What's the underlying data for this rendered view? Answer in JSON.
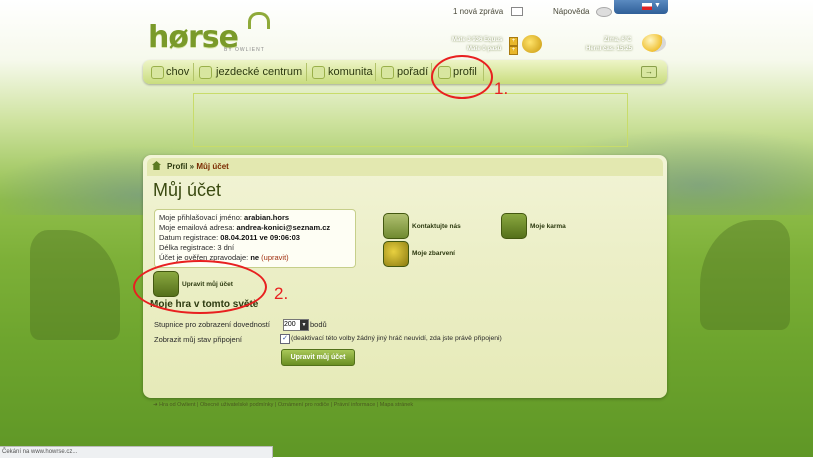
{
  "header": {
    "logo": "hørse",
    "logo_sub": "BY OWLIENT",
    "new_message": "1 nová zpráva",
    "help": "Nápověda",
    "lang_flag": "cz-flag-icon",
    "equus_line": "Máte 3 936 Equus",
    "pass_line": "Máte 0 pasů",
    "weather_line": "Zima, 6°C",
    "time_line": "Herní čas: 15:25"
  },
  "nav": {
    "items": [
      {
        "label": "chov",
        "icon": "horse-icon"
      },
      {
        "label": "jezdecké centrum",
        "icon": "stable-icon"
      },
      {
        "label": "komunita",
        "icon": "community-icon"
      },
      {
        "label": "pořadí",
        "icon": "ranking-icon"
      },
      {
        "label": "profil",
        "icon": "profile-icon"
      }
    ]
  },
  "breadcrumb": {
    "root": "Profil",
    "sep": " » ",
    "current": "Můj účet"
  },
  "page_title": "Můj účet",
  "account": {
    "login_label": "Moje přihlašovací jméno: ",
    "login_value": "arabian.hors",
    "email_label": "Moje emailová adresa: ",
    "email_value": "andrea-konici@seznam.cz",
    "regdate_label": "Datum registrace: ",
    "regdate_value": "08.04.2011 ve 09:06:03",
    "reglen_label": "Délka registrace: ",
    "reglen_value": "3 dní",
    "confirm_label": "Účet je ověřen zpravodaje: ",
    "confirm_value": "ne",
    "confirm_link": "(upravit)"
  },
  "actions": {
    "contact": "Kontaktujte nás",
    "karma": "Moje karma",
    "colors": "Moje zbarvení",
    "edit_account": "Upravit můj účet"
  },
  "game_section": {
    "title": "Moje hra v tomto světě",
    "scale_label": "Stupnice pro zobrazení dovedností",
    "scale_value": "200",
    "scale_unit": "bodů",
    "status_label": "Zobrazit můj stav připojení",
    "status_note": "(deaktivací této volby žádný jiný hráč neuvidí, zda jste právě připojeni)",
    "submit": "Upravit můj účet"
  },
  "footer": {
    "text": "Hra od Owlient | Obecné uživatelské podmínky | Oznámení pro rodiče | Právní informace | Mapa stránek"
  },
  "statusbar": "Čekání na www.howrse.cz...",
  "annotations": {
    "one": "1.",
    "two": "2."
  },
  "colors": {
    "accent": "#7a9a2a",
    "annotation": "#e82020"
  }
}
